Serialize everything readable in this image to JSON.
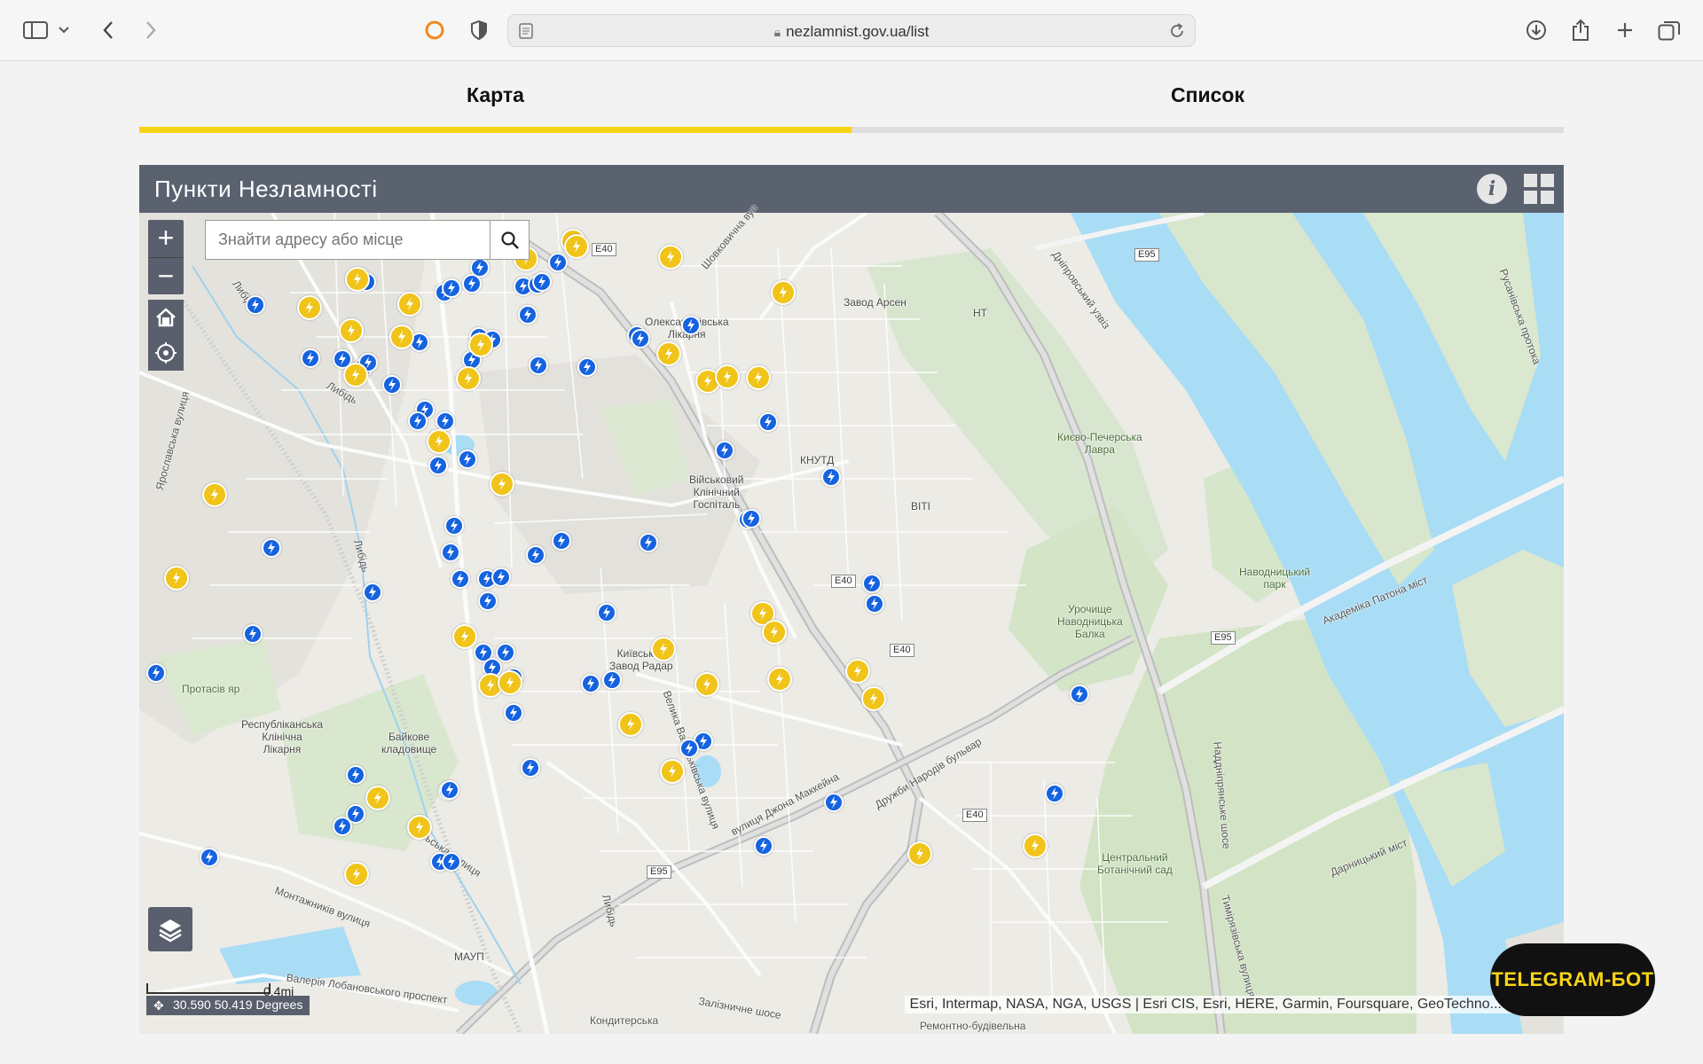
{
  "browser": {
    "url": "nezlamnist.gov.ua/list",
    "icons": [
      "sidebar-icon",
      "chevron-down-icon",
      "back-icon",
      "forward-icon",
      "extension-circle-icon",
      "shield-icon",
      "page-icon",
      "lock-icon",
      "reload-icon",
      "download-icon",
      "share-icon",
      "new-tab-icon",
      "tabs-overview-icon"
    ]
  },
  "tabs": [
    {
      "label": "Карта",
      "active": true
    },
    {
      "label": "Список",
      "active": false
    }
  ],
  "app": {
    "title": "Пункти Незламності",
    "search_placeholder": "Знайти адресу або місце",
    "zoom_in": "+",
    "zoom_out": "−",
    "scale_label": "0.4mi",
    "coords": "30.590 50.419 Degrees",
    "attribution": "Esri, Intermap, NASA, NGA, USGS | Esri CIS, Esri, HERE, Garmin, Foursquare, GeoTechno...",
    "esri_logo": "esri"
  },
  "map_labels": {
    "oleksandrivska": "Олександрівська\nЛікарня",
    "zavod_arsen": "Завод Арсен",
    "nt": "НТ",
    "kpl": "Києво-Печерська\nЛавра",
    "knutd": "КНУТД",
    "viti": "ВІТІ",
    "hospital": "Військовий\nКлінічний\nГоспіталь",
    "naberezhnyi": "Наводницький\nпарк",
    "balka": "Урочище\nНаводницька\nБалка",
    "radar": "Київський\nЗавод Радар",
    "protasiv": "Протасів яр",
    "klinichna": "Республіканська\nКлінічна\nЛікарня",
    "baikove": "Байкове\nкладовище",
    "botanic": "Центральний\nБотанічний сад",
    "maup": "МАУП",
    "patona": "Академіка Патона міст",
    "darnytskyi": "Дарницький міст",
    "druzhby": "Дружби Народів бульвар",
    "velyka_vasylkivska": "Велика Васильківська вулиця",
    "dniprovskyi": "Дніпровський узвіз",
    "rusanivska": "Русанівська протока",
    "naddniprianske": "Наддніпрянське шосе",
    "shovkovychna": "Шовковична вул",
    "lybid1": "Либідь",
    "lybid2": "Либідь",
    "lybid3": "Либідь",
    "lybid4": "Либідь",
    "volska": "Вольська вулиця",
    "montazhnykiv": "Монтажників вулиця",
    "dzhona_makkeina": "вулиця Джона Маккейна",
    "zaliznychne": "Залізничне шосе",
    "konditerska": "Кондитерська",
    "remontno": "Ремонтно-будівельна",
    "lobanovskoho": "Валерія Лобановського проспект",
    "timiriazivska": "Тимірязівська вулиця",
    "yaroshska": "Ярославська вулиця",
    "e40a": "E40",
    "e40b": "E40",
    "e40c": "E40",
    "e40d": "E40",
    "e95a": "E95",
    "e95b": "E95",
    "e95c": "E95"
  },
  "markers": {
    "legend": {
      "blue": "#1663e0",
      "yellow": "#f0c419"
    },
    "blue_count": 74,
    "yellow_count": 36
  },
  "telegram_button": "TELEGRAM-БОТ",
  "colors": {
    "accent": "#f7d417",
    "header": "#5a6270",
    "water": "#a9dcf5"
  }
}
